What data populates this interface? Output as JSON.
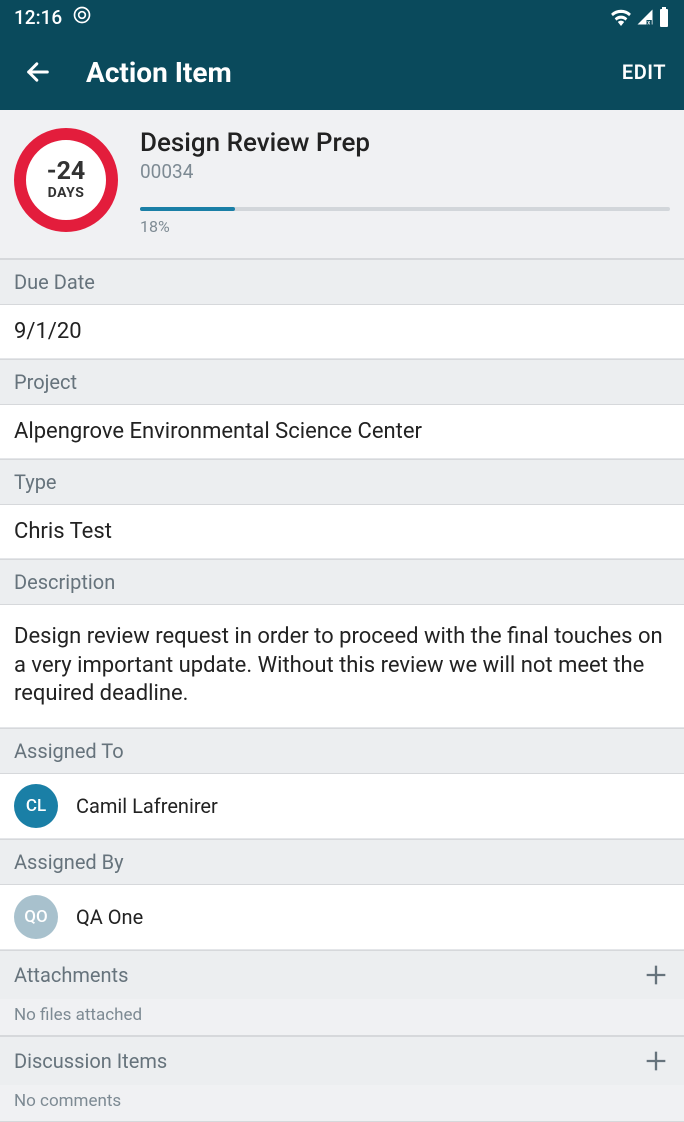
{
  "status_bar": {
    "time": "12:16"
  },
  "app_bar": {
    "title": "Action Item",
    "edit_label": "EDIT"
  },
  "header": {
    "days_value": "-24",
    "days_label": "DAYS",
    "title": "Design Review Prep",
    "id": "00034",
    "progress_pct": "18%",
    "progress_value": 18
  },
  "sections": {
    "due_date": {
      "label": "Due Date",
      "value": "9/1/20"
    },
    "project": {
      "label": "Project",
      "value": "Alpengrove Environmental Science Center"
    },
    "type": {
      "label": "Type",
      "value": "Chris Test"
    },
    "description": {
      "label": "Description",
      "value": "Design review request in order to proceed with the final touches on a very important update. Without this review we will not meet the required deadline."
    },
    "assigned_to": {
      "label": "Assigned To",
      "person": {
        "initials": "CL",
        "name": "Camil Lafrenirer"
      }
    },
    "assigned_by": {
      "label": "Assigned By",
      "person": {
        "initials": "QO",
        "name": "QA One"
      }
    },
    "attachments": {
      "label": "Attachments",
      "empty_text": "No files attached"
    },
    "discussion": {
      "label": "Discussion Items",
      "empty_text": "No comments"
    }
  }
}
